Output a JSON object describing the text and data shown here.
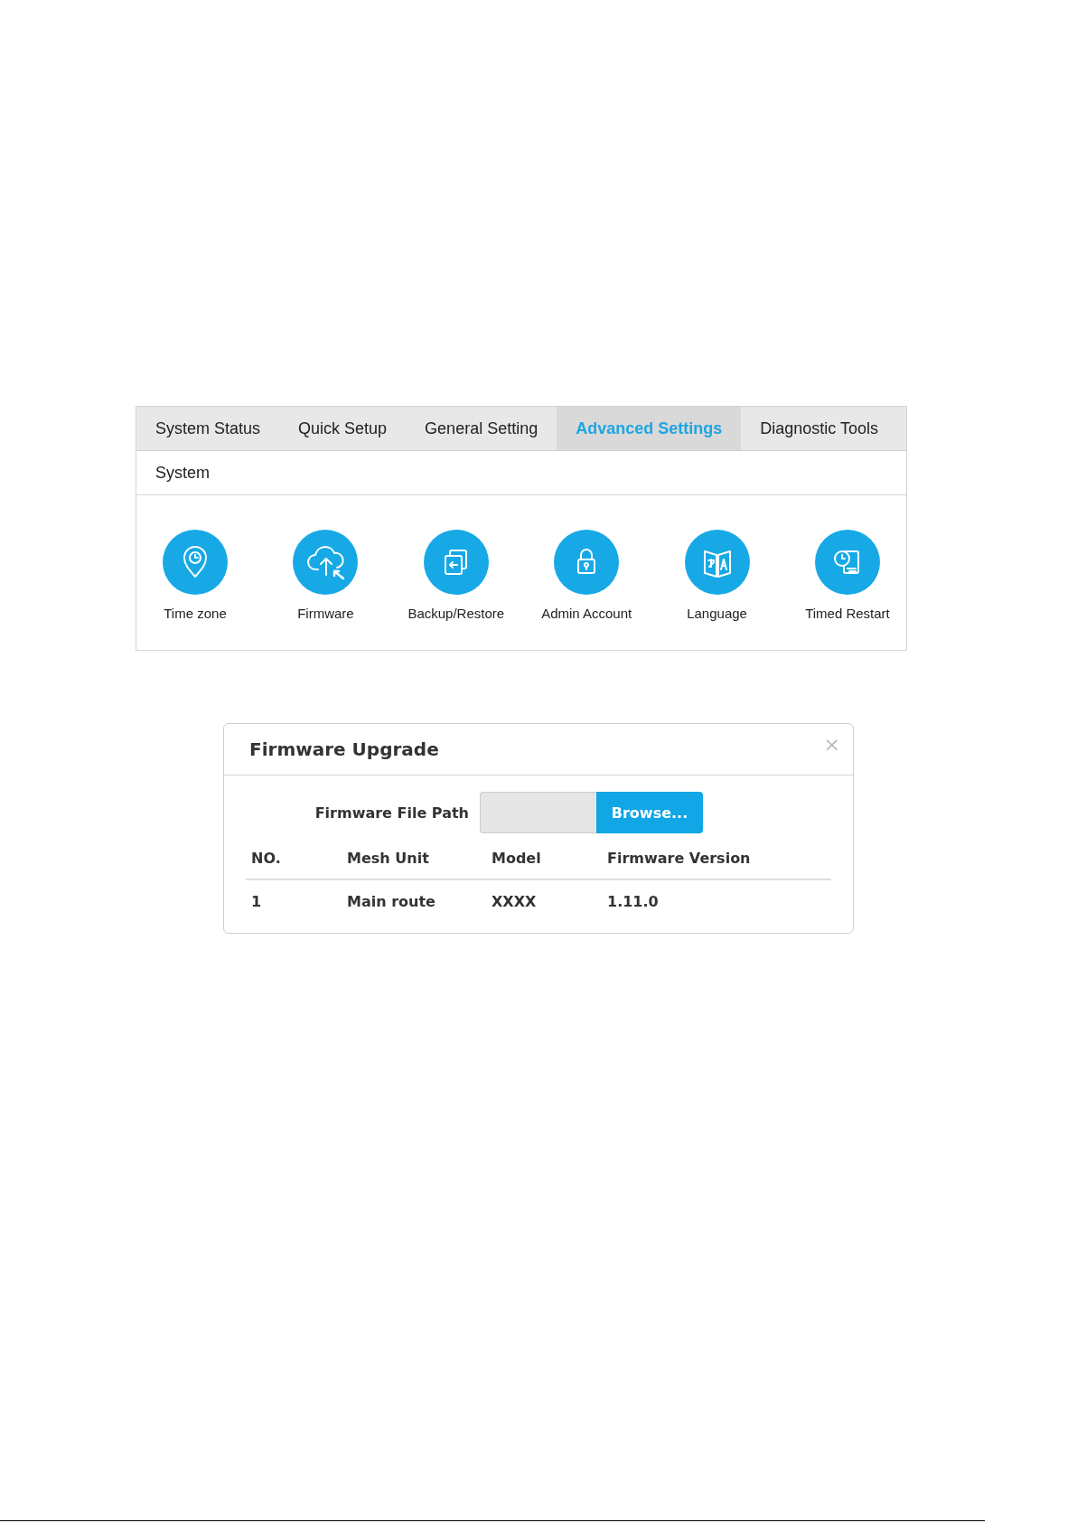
{
  "tabs": [
    {
      "label": "System Status",
      "selected": false
    },
    {
      "label": "Quick Setup",
      "selected": false
    },
    {
      "label": "General Setting",
      "selected": false
    },
    {
      "label": "Advanced Settings",
      "selected": true
    },
    {
      "label": "Diagnostic Tools",
      "selected": false
    }
  ],
  "section": {
    "title": "System"
  },
  "items": [
    {
      "label": "Time zone",
      "kind": "timezone"
    },
    {
      "label": "Firmware",
      "kind": "firmware"
    },
    {
      "label": "Backup/Restore",
      "kind": "backup"
    },
    {
      "label": "Admin Account",
      "kind": "admin"
    },
    {
      "label": "Language",
      "kind": "language"
    },
    {
      "label": "Timed Restart",
      "kind": "restart"
    }
  ],
  "dialog": {
    "title": "Firmware Upgrade",
    "close": "×",
    "file_path": {
      "label": "Firmware File Path",
      "button": "Browse..."
    },
    "table": {
      "columns": [
        "NO.",
        "Mesh Unit",
        "Model",
        "Firmware Version"
      ],
      "rows": [
        [
          "1",
          "Main route",
          "XXXX",
          "1.11.0"
        ]
      ]
    }
  }
}
